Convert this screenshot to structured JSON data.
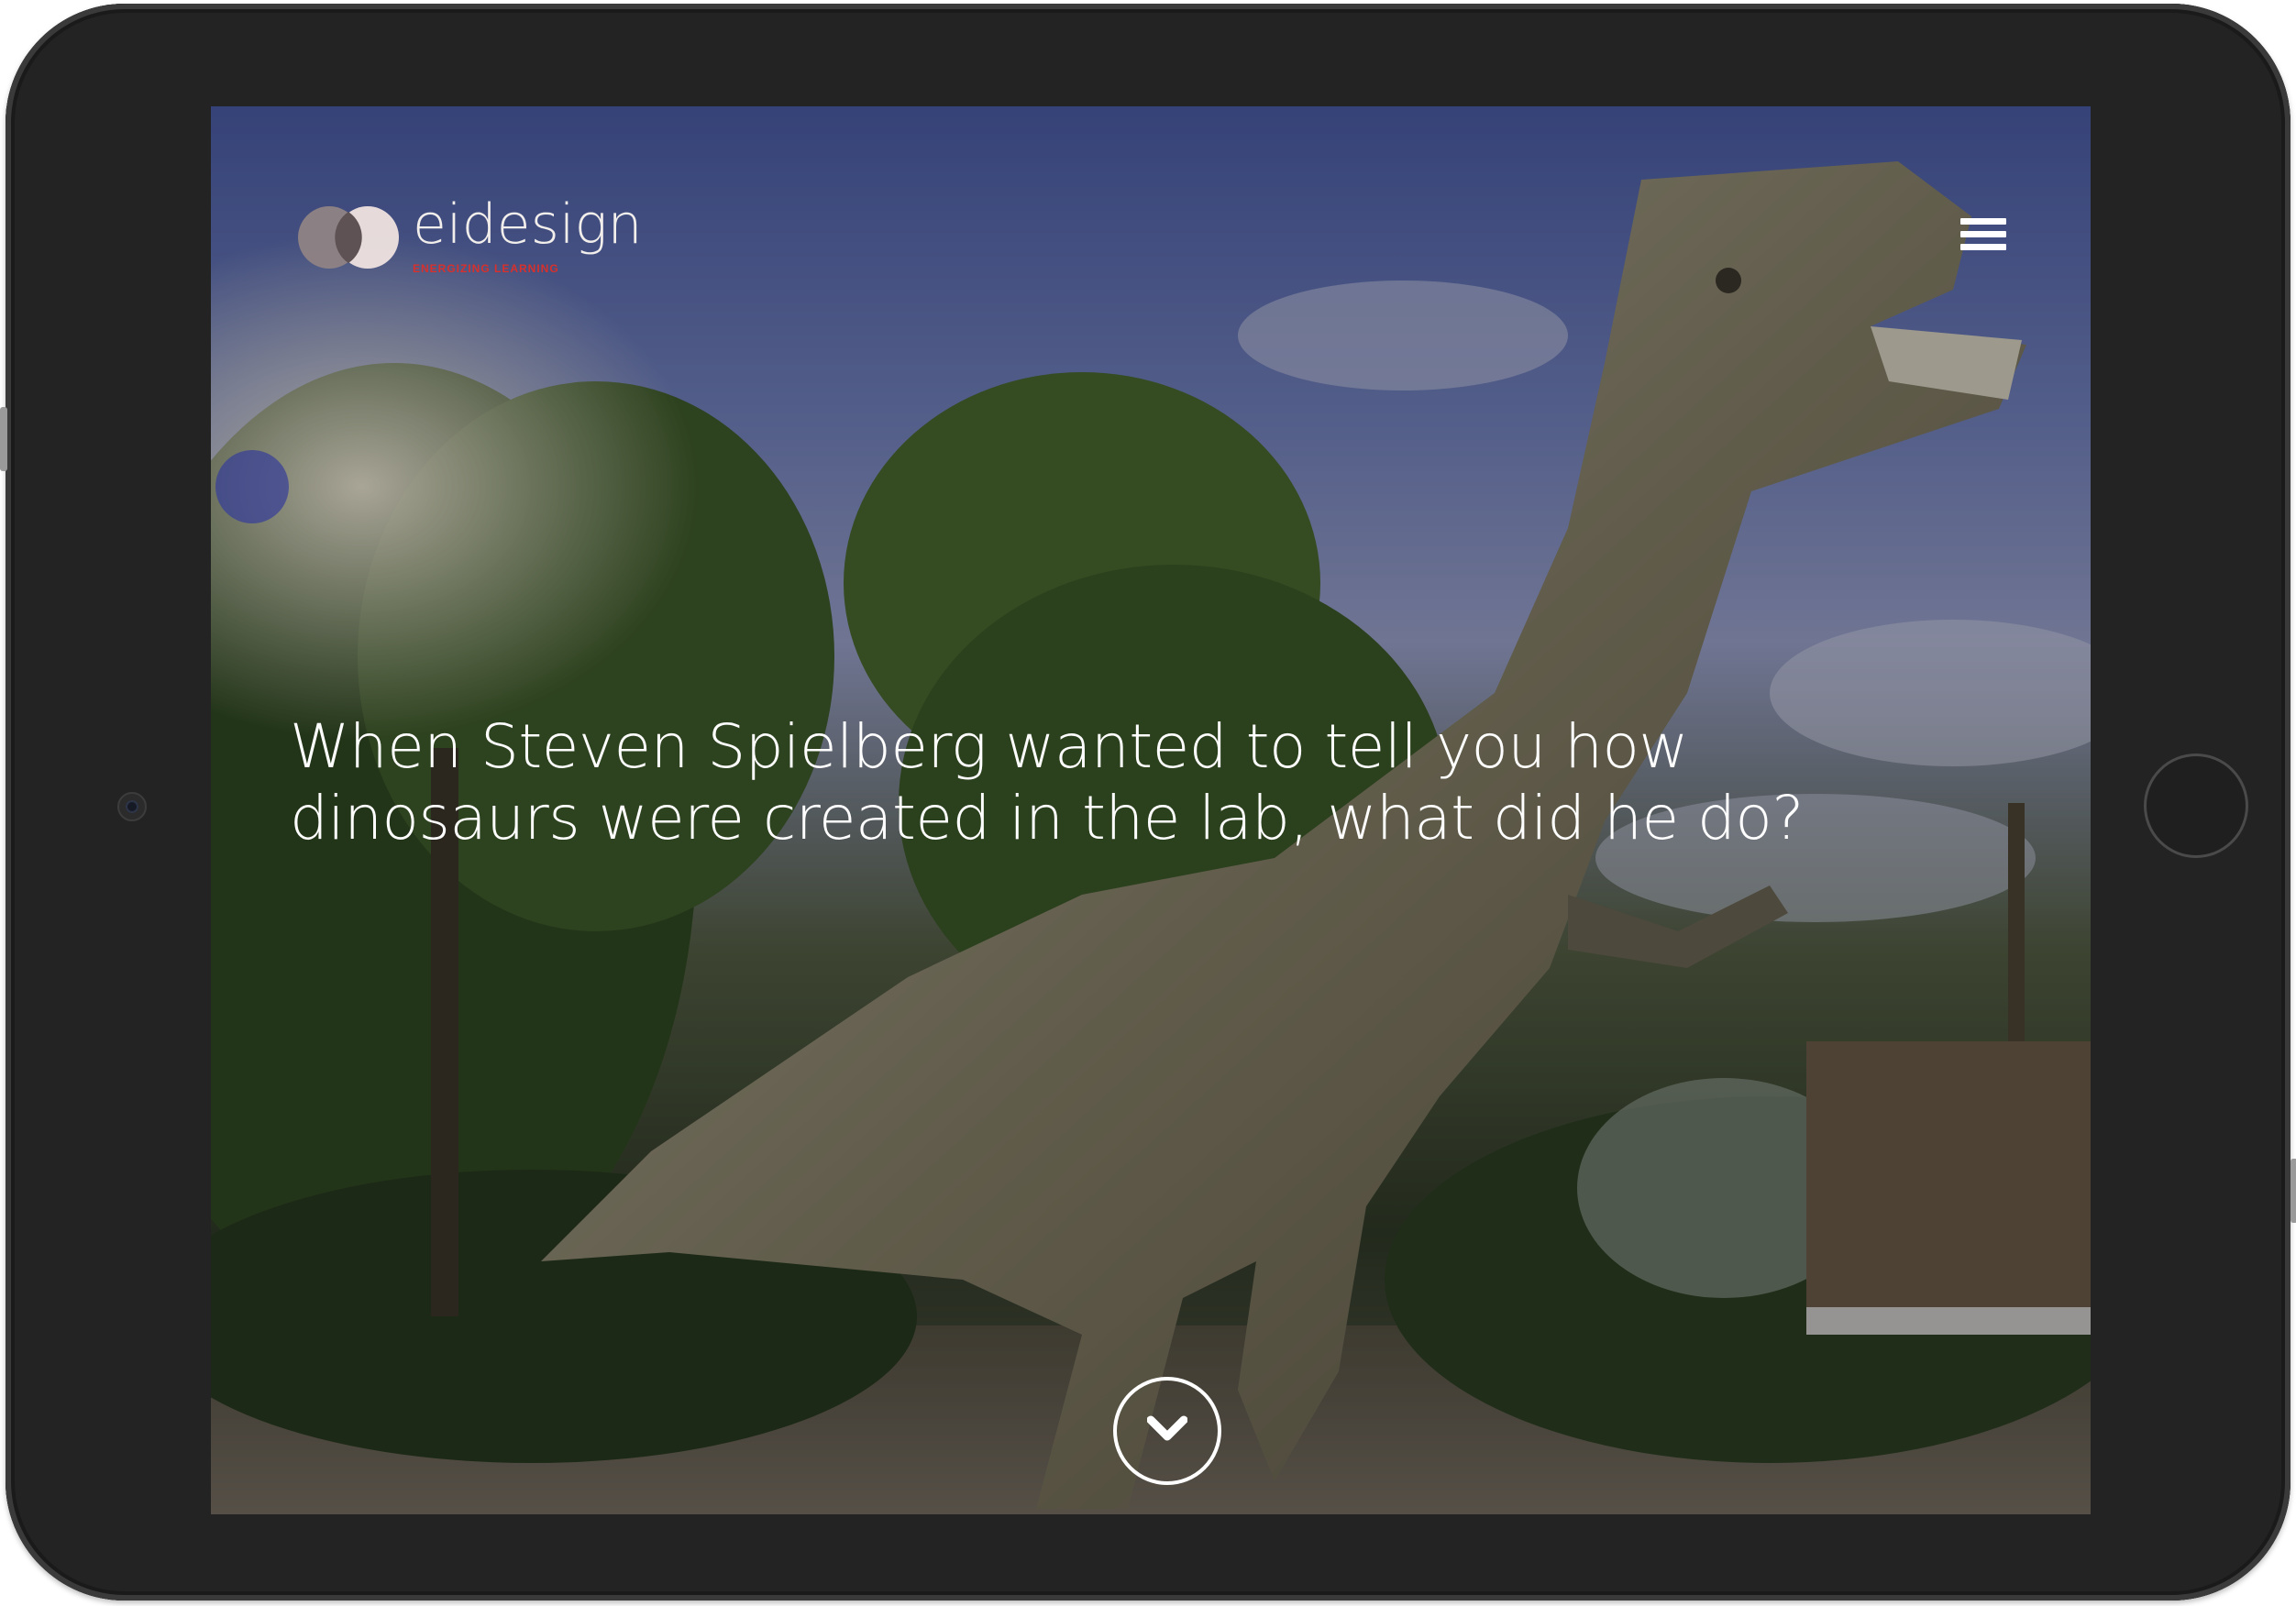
{
  "brand": {
    "name": "eidesign",
    "tagline": "ENERGIZING LEARNING",
    "accent_color": "#d8302c"
  },
  "header": {
    "menu_icon": "hamburger-menu-icon"
  },
  "hero": {
    "headline_line1": "When Steven Spielberg wanted to tell you how",
    "headline_line2": "dinosaurs were created in the lab, what did he do?",
    "scroll_icon": "chevron-down-icon"
  }
}
